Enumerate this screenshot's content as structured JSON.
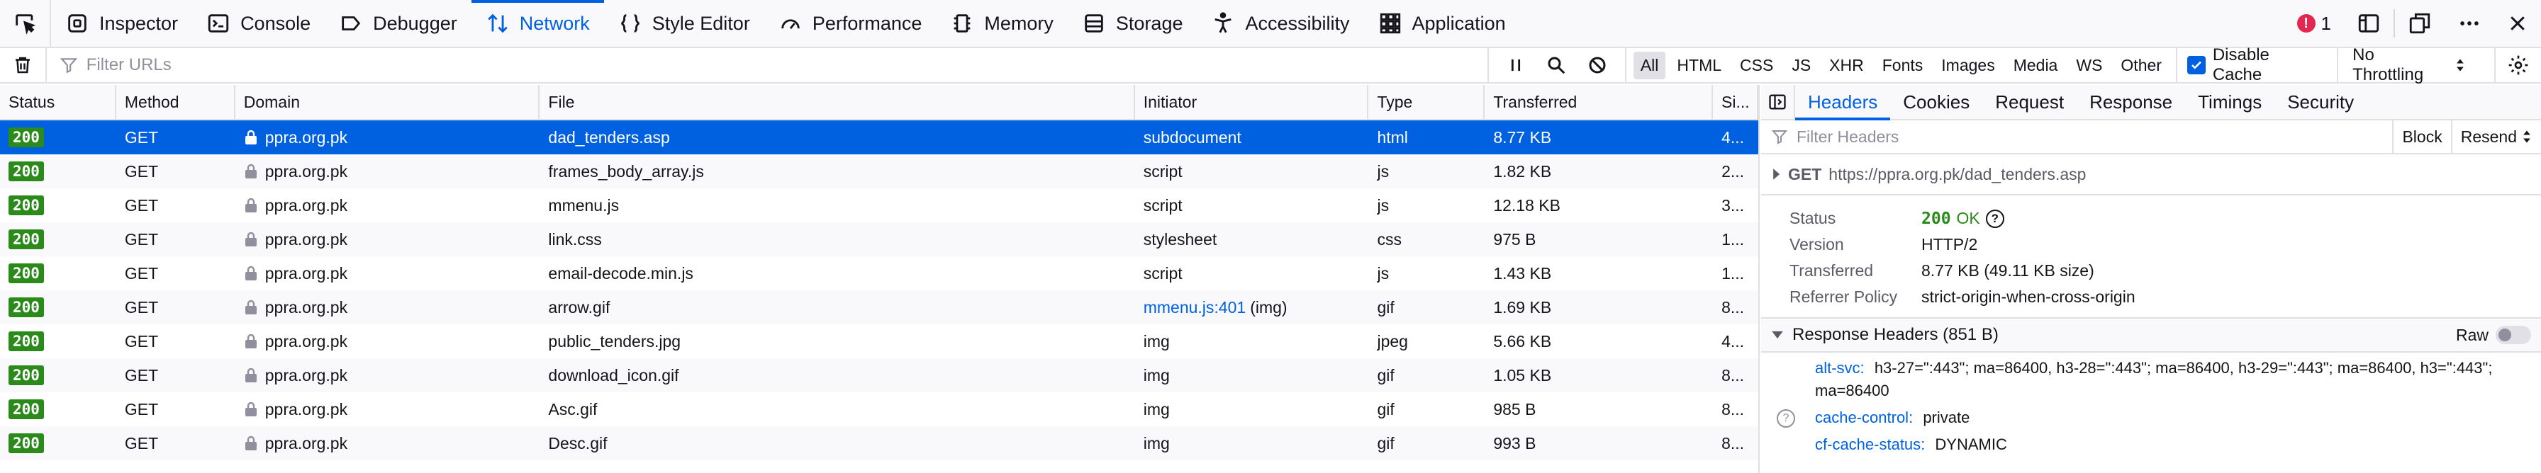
{
  "toolbar": {
    "tabs": [
      {
        "label": "Inspector",
        "icon": "inspector-icon"
      },
      {
        "label": "Console",
        "icon": "console-icon"
      },
      {
        "label": "Debugger",
        "icon": "debugger-icon"
      },
      {
        "label": "Network",
        "icon": "network-icon",
        "active": true
      },
      {
        "label": "Style Editor",
        "icon": "style-editor-icon"
      },
      {
        "label": "Performance",
        "icon": "performance-icon"
      },
      {
        "label": "Memory",
        "icon": "memory-icon"
      },
      {
        "label": "Storage",
        "icon": "storage-icon"
      },
      {
        "label": "Accessibility",
        "icon": "accessibility-icon"
      },
      {
        "label": "Application",
        "icon": "application-icon"
      }
    ],
    "error_count": "1"
  },
  "filterbar": {
    "filter_placeholder": "Filter URLs",
    "type_filters": [
      "All",
      "HTML",
      "CSS",
      "JS",
      "XHR",
      "Fonts",
      "Images",
      "Media",
      "WS",
      "Other"
    ],
    "active_type": "All",
    "disable_cache_label": "Disable Cache",
    "disable_cache_checked": true,
    "throttling_label": "No Throttling"
  },
  "table": {
    "columns": [
      "Status",
      "Method",
      "Domain",
      "File",
      "Initiator",
      "Type",
      "Transferred",
      "Si..."
    ],
    "rows": [
      {
        "status": "200",
        "method": "GET",
        "domain": "ppra.org.pk",
        "file": "dad_tenders.asp",
        "initiator": "subdocument",
        "initiator_link": "",
        "initiator_suffix": "",
        "type": "html",
        "transferred": "8.77 KB",
        "size": "4...",
        "selected": true
      },
      {
        "status": "200",
        "method": "GET",
        "domain": "ppra.org.pk",
        "file": "frames_body_array.js",
        "initiator": "script",
        "initiator_link": "",
        "initiator_suffix": "",
        "type": "js",
        "transferred": "1.82 KB",
        "size": "2..."
      },
      {
        "status": "200",
        "method": "GET",
        "domain": "ppra.org.pk",
        "file": "mmenu.js",
        "initiator": "script",
        "initiator_link": "",
        "initiator_suffix": "",
        "type": "js",
        "transferred": "12.18 KB",
        "size": "3..."
      },
      {
        "status": "200",
        "method": "GET",
        "domain": "ppra.org.pk",
        "file": "link.css",
        "initiator": "stylesheet",
        "initiator_link": "",
        "initiator_suffix": "",
        "type": "css",
        "transferred": "975 B",
        "size": "1..."
      },
      {
        "status": "200",
        "method": "GET",
        "domain": "ppra.org.pk",
        "file": "email-decode.min.js",
        "initiator": "script",
        "initiator_link": "",
        "initiator_suffix": "",
        "type": "js",
        "transferred": "1.43 KB",
        "size": "1..."
      },
      {
        "status": "200",
        "method": "GET",
        "domain": "ppra.org.pk",
        "file": "arrow.gif",
        "initiator": "",
        "initiator_link": "mmenu.js:401",
        "initiator_suffix": "(img)",
        "type": "gif",
        "transferred": "1.69 KB",
        "size": "8..."
      },
      {
        "status": "200",
        "method": "GET",
        "domain": "ppra.org.pk",
        "file": "public_tenders.jpg",
        "initiator": "img",
        "initiator_link": "",
        "initiator_suffix": "",
        "type": "jpeg",
        "transferred": "5.66 KB",
        "size": "4..."
      },
      {
        "status": "200",
        "method": "GET",
        "domain": "ppra.org.pk",
        "file": "download_icon.gif",
        "initiator": "img",
        "initiator_link": "",
        "initiator_suffix": "",
        "type": "gif",
        "transferred": "1.05 KB",
        "size": "8..."
      },
      {
        "status": "200",
        "method": "GET",
        "domain": "ppra.org.pk",
        "file": "Asc.gif",
        "initiator": "img",
        "initiator_link": "",
        "initiator_suffix": "",
        "type": "gif",
        "transferred": "985 B",
        "size": "8..."
      },
      {
        "status": "200",
        "method": "GET",
        "domain": "ppra.org.pk",
        "file": "Desc.gif",
        "initiator": "img",
        "initiator_link": "",
        "initiator_suffix": "",
        "type": "gif",
        "transferred": "993 B",
        "size": "8..."
      }
    ]
  },
  "details": {
    "tabs": [
      "Headers",
      "Cookies",
      "Request",
      "Response",
      "Timings",
      "Security"
    ],
    "active_tab": "Headers",
    "filter_placeholder": "Filter Headers",
    "block_label": "Block",
    "resend_label": "Resend",
    "request_method": "GET",
    "request_url": "https://ppra.org.pk/dad_tenders.asp",
    "summary": {
      "status_label": "Status",
      "status_code": "200",
      "status_text": "OK",
      "version_label": "Version",
      "version": "HTTP/2",
      "transferred_label": "Transferred",
      "transferred": "8.77 KB (49.11 KB size)",
      "referrer_label": "Referrer Policy",
      "referrer": "strict-origin-when-cross-origin"
    },
    "response_headers_title": "Response Headers (851 B)",
    "raw_label": "Raw",
    "response_headers": [
      {
        "name": "alt-svc:",
        "value": "h3-27=\":443\"; ma=86400, h3-28=\":443\"; ma=86400, h3-29=\":443\"; ma=86400, h3=\":443\"; ma=86400"
      },
      {
        "name": "cache-control:",
        "value": "private"
      },
      {
        "name": "cf-cache-status:",
        "value": "DYNAMIC"
      }
    ]
  },
  "colors": {
    "accent": "#0061e0",
    "status_ok": "#2a8a1a",
    "error_badge": "#e22850"
  }
}
